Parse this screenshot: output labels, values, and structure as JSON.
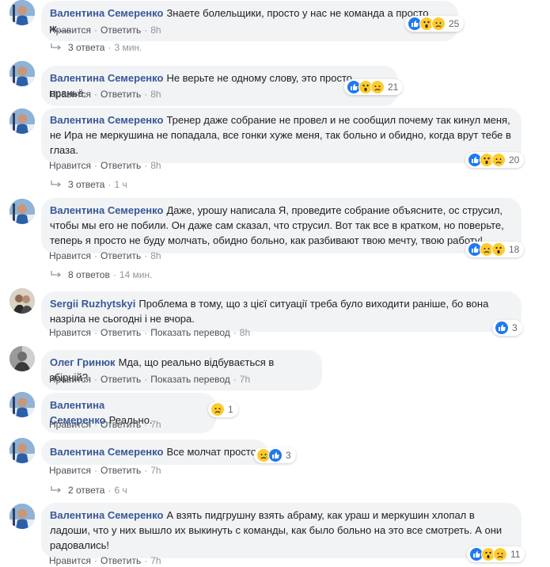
{
  "labels": {
    "like": "Нравится",
    "reply": "Ответить",
    "translate": "Показать перевод"
  },
  "separator": "·",
  "comments": [
    {
      "author": "Валентина Семеренко",
      "text": "Знаете болельщики, просто у нас не команда а просто ж.....",
      "time": "8h",
      "reactions": [
        "like",
        "wow",
        "sad"
      ],
      "reaction_count": "25"
    },
    {
      "author": "Валентина Семеренко",
      "text": "Не верьте не одному слову, это просто враньё.",
      "time": "8h",
      "reactions": [
        "like",
        "wow",
        "sad"
      ],
      "reaction_count": "21"
    },
    {
      "author": "Валентина Семеренко",
      "text": "Тренер даже собрание не провел и не сообщил почему так кинул меня, не Ира не меркушина не попадала, все гонки хуже меня, так больно и обидно, когда врут тебе в глаза.",
      "time": "8h",
      "reactions": [
        "like",
        "wow",
        "sad"
      ],
      "reaction_count": "20"
    },
    {
      "author": "Валентина Семеренко",
      "text": "Даже, урошу написала Я, проведите собрание объясните, ос струсил, чтобы мы его не побили. Он даже сам сказал, что струсил. Вот так все в кратком, но поверьте, теперь я просто не буду молчать, обидно больно, как разбивают твою мечту, твою работу!",
      "time": "8h",
      "reactions": [
        "like",
        "sad",
        "wow"
      ],
      "reaction_count": "18"
    },
    {
      "author": "Sergii Ruzhytskyi",
      "text": "Проблема в тому, що з цієї ситуації треба було виходити раніше, бо вона назріла не сьогодні і не вчора.",
      "time": "8h",
      "reactions": [
        "like"
      ],
      "reaction_count": "3"
    },
    {
      "author": "Олег Гринюк",
      "text": "Мда, що реально відбувається в збірній?",
      "time": "7h",
      "reactions": [],
      "reaction_count": ""
    },
    {
      "author": "Валентина Семеренко",
      "text": "Реально.",
      "time": "7h",
      "reactions": [
        "sad"
      ],
      "reaction_count": "1"
    },
    {
      "author": "Валентина Семеренко",
      "text": "Все молчат просто",
      "time": "7h",
      "reactions": [
        "sad",
        "like"
      ],
      "reaction_count": "3"
    },
    {
      "author": "Валентина Семеренко",
      "text": "А взять пидгрушну взять абраму, как ураш и меркушин хлопал в ладоши, что у них вышло их выкинуть с команды, как было больно на это все смотреть. А они радовались!",
      "time": "7h",
      "reactions": [
        "like",
        "wow",
        "sad"
      ],
      "reaction_count": "11"
    }
  ],
  "reply_threads": [
    {
      "label": "3 ответа",
      "time": "3 мин."
    },
    {
      "label": "3 ответа",
      "time": "1 ч"
    },
    {
      "label": "8 ответов",
      "time": "14 мин."
    },
    {
      "label": "2 ответа",
      "time": "6 ч"
    }
  ],
  "colors": {
    "name": "#385898",
    "bubble": "#f2f3f5",
    "meta": "#90949c",
    "like": "#2078f4",
    "emoji": "#fecb2f"
  }
}
